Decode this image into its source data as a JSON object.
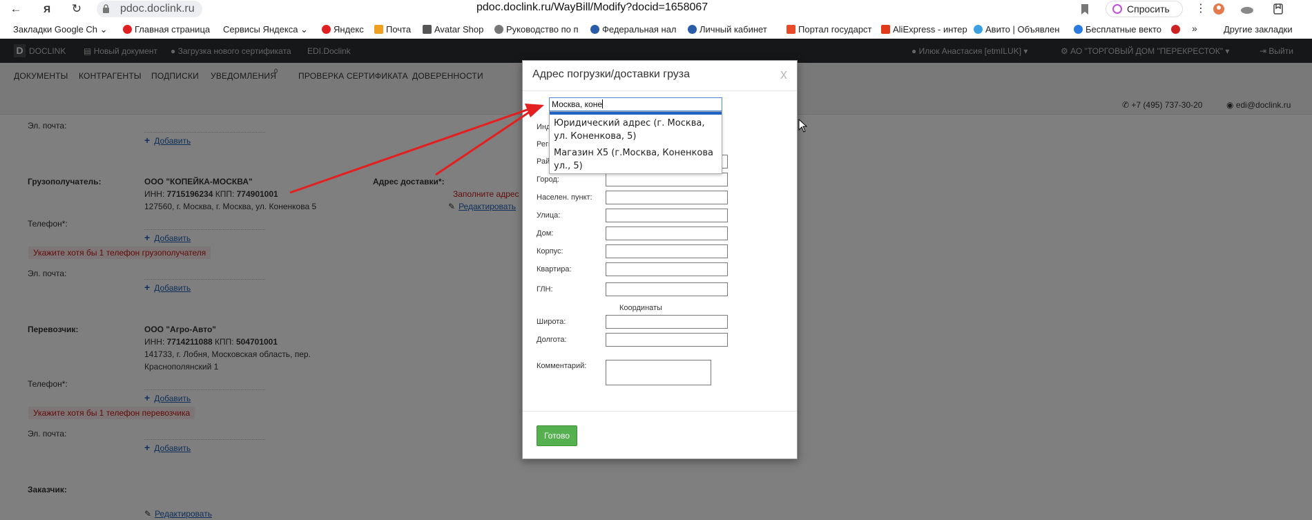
{
  "browser": {
    "url_short": "pdoc.doclink.ru",
    "url_full": "pdoc.doclink.ru/WayBill/Modify?docid=1658067",
    "ask_label": "Спросить",
    "bookmarks": [
      "Закладки Google Ch",
      "Главная страница",
      "Сервисы Яндекса",
      "Яндекс",
      "Почта",
      "Avatar Shop",
      "Руководство по п",
      "Федеральная нал",
      "Личный кабинет",
      "Портал государст",
      "AliExpress - интер",
      "Авито | Объявлен",
      "Бесплатные векто",
      "Другие закладки"
    ],
    "bookmark_colors": [
      "#ffffff",
      "#e02020",
      "#ffffff",
      "#e02020",
      "#f0a020",
      "#555555",
      "#777777",
      "#2a5caa",
      "#2a5caa",
      "#e84a2a",
      "#e03a1a",
      "#3aa0e0",
      "#2a7adf",
      "#cc2222"
    ]
  },
  "header": {
    "logo_letter": "D",
    "brand": "DOCLINK",
    "new_doc": "Новый документ",
    "upload_cert": "Загрузка нового сертификата",
    "edi": "EDI.Doclink",
    "user": "Илюк Анастасия [etmILUK]",
    "company": "АО \"ТОРГОВЫЙ ДОМ \"ПЕРЕКРЕСТОК\"",
    "logout": "Выйти"
  },
  "menu": {
    "items": [
      "ДОКУМЕНТЫ",
      "КОНТРАГЕНТЫ",
      "ПОДПИСКИ",
      "УВЕДОМЛЕНИЯ",
      "ПРОВЕРКА СЕРТИФИКАТА",
      "ДОВЕРЕННОСТИ"
    ],
    "notif_count": "0",
    "phone": "+7 (495) 737-30-20",
    "email": "edi@doclink.ru"
  },
  "page": {
    "email_label": "Эл. почта:",
    "phone_label": "Телефон*:",
    "add_label": "Добавить",
    "edit_label": "Редактировать",
    "consignee": {
      "label": "Грузополучатель:",
      "name": "ООО \"КОПЕЙКА-МОСКВА\"",
      "inn_prefix": "ИНН: ",
      "inn": "7715196234",
      "kpp_prefix": " КПП: ",
      "kpp": "774901001",
      "address": "127560, г. Москва, г. Москва, ул. Коненкова 5",
      "error": "Укажите хотя бы 1 телефон грузополучателя"
    },
    "delivery": {
      "label": "Адрес доставки*:",
      "error": "Заполните адрес"
    },
    "carrier": {
      "label": "Перевозчик:",
      "name": "ООО \"Агро-Авто\"",
      "inn_prefix": "ИНН: ",
      "inn": "7714211088",
      "kpp_prefix": " КПП: ",
      "kpp": "504701001",
      "address1": "141733, г. Лобня, Московская область, пер.",
      "address2": "Краснополянский 1",
      "error": "Укажите хотя бы 1 телефон перевозчика"
    },
    "customer": {
      "label": "Заказчик:"
    }
  },
  "modal": {
    "title": "Адрес погрузки/доставки груза",
    "close": "x",
    "search_value": "Москва, коне",
    "suggestions": [
      "Юридический адрес (г. Москва, ул. Коненкова, 5)",
      "Магазин X5 (г.Москва, Коненкова ул., 5)"
    ],
    "fields": {
      "index": "Инд",
      "region": "Реги",
      "district": "Рай",
      "city": "Город:",
      "settlement": "Населен. пункт:",
      "street": "Улица:",
      "house": "Дом:",
      "building": "Корпус:",
      "flat": "Квартира:",
      "gln": "ГЛН:",
      "coords": "Координаты",
      "lat": "Широта:",
      "lon": "Долгота:",
      "comment": "Комментарий:"
    },
    "done": "Готово"
  },
  "colors": {
    "accent_red": "#e41f1f",
    "done_green": "#55b14f",
    "link_blue": "#1e5fb4"
  }
}
